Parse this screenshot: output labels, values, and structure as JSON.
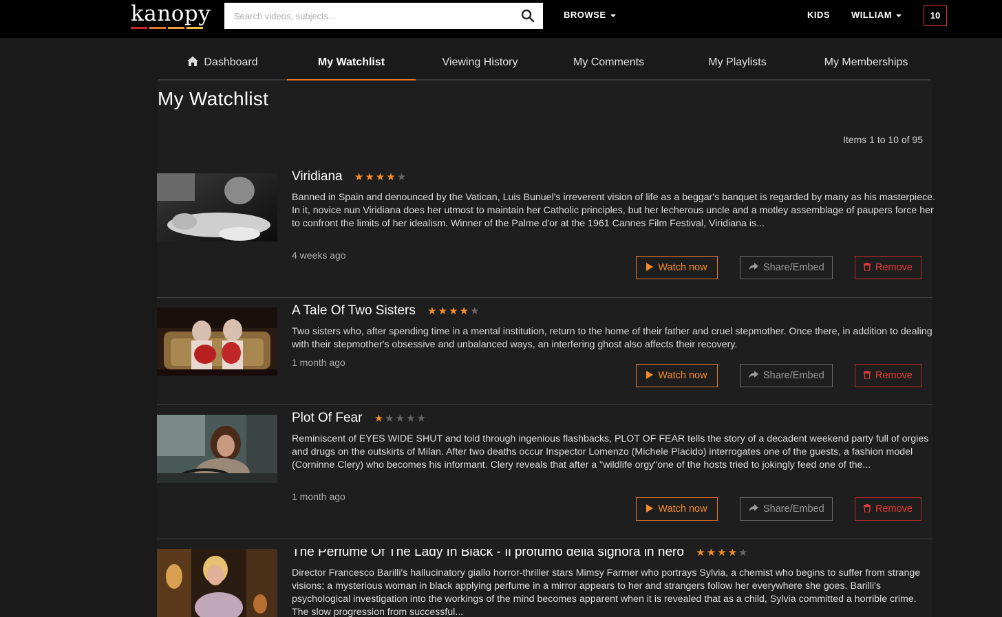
{
  "header": {
    "logo_text": "kanopy",
    "logo_bar_colors": [
      "#c62828",
      "#e8762b",
      "#f2a33a",
      "#f5c242"
    ],
    "search_placeholder": "Search videos, subjects...",
    "browse_label": "BROWSE",
    "kids_label": "KIDS",
    "user_label": "WILLIAM",
    "badge_count": "10"
  },
  "tabs": [
    {
      "label": "Dashboard",
      "icon": "home-icon"
    },
    {
      "label": "My Watchlist",
      "active": true
    },
    {
      "label": "Viewing History"
    },
    {
      "label": "My Comments"
    },
    {
      "label": "My Playlists"
    },
    {
      "label": "My Memberships"
    }
  ],
  "page": {
    "title": "My Watchlist",
    "items_count": "Items 1 to 10 of 95"
  },
  "buttons": {
    "watch": "Watch now",
    "share": "Share/Embed",
    "remove": "Remove"
  },
  "colors": {
    "accent": "#e8762b",
    "remove": "#e53935",
    "background": "#1a1a1a"
  },
  "items": [
    {
      "title": "Viridiana",
      "rating": 4,
      "description": "Banned in Spain and denounced by the Vatican, Luis Bunuel's irreverent vision of life as a beggar's banquet is regarded by many as his masterpiece. In it, novice nun Viridiana does her utmost to maintain her Catholic principles, but her lecherous uncle and a motley assemblage of paupers force her to confront the limits of her idealism. Winner of the Palme d'or at the 1961 Cannes Film Festival, Viridiana is...",
      "time": "4 weeks ago"
    },
    {
      "title": "A Tale Of Two Sisters",
      "rating": 4,
      "description": "Two sisters who, after spending time in a mental institution, return to the home of their father and cruel stepmother. Once there, in addition to dealing with their stepmother's obsessive and unbalanced ways, an interfering ghost also affects their recovery.",
      "time": "1 month ago"
    },
    {
      "title": "Plot Of Fear",
      "rating": 1,
      "description": "Reminiscent of EYES WIDE SHUT and told through ingenious flashbacks, PLOT OF FEAR tells the story of a decadent weekend party full of orgies and drugs on the outskirts of Milan. After two deaths occur Inspector Lomenzo (Michele Placido) interrogates one of the guests, a fashion model (Corninne Clery) who becomes his informant. Clery reveals that after a \"wildlife orgy\"one of the hosts tried to jokingly feed one of the...",
      "time": "1 month ago"
    },
    {
      "title": "The Perfume Of The Lady In Black - Il profumo della signora in nero",
      "rating": 4,
      "description": "Director Francesco Barilli's hallucinatory giallo horror-thriller stars Mimsy Farmer who portrays Sylvia, a chemist who begins to suffer from strange visions; a mysterious woman in black applying perfume in a mirror appears to her and strangers follow her everywhere she goes. Barilli's psychological investigation into the workings of the mind becomes apparent when it is revealed that as a child, Sylvia committed a horrible crime. The slow progression from successful...",
      "time": ""
    }
  ]
}
